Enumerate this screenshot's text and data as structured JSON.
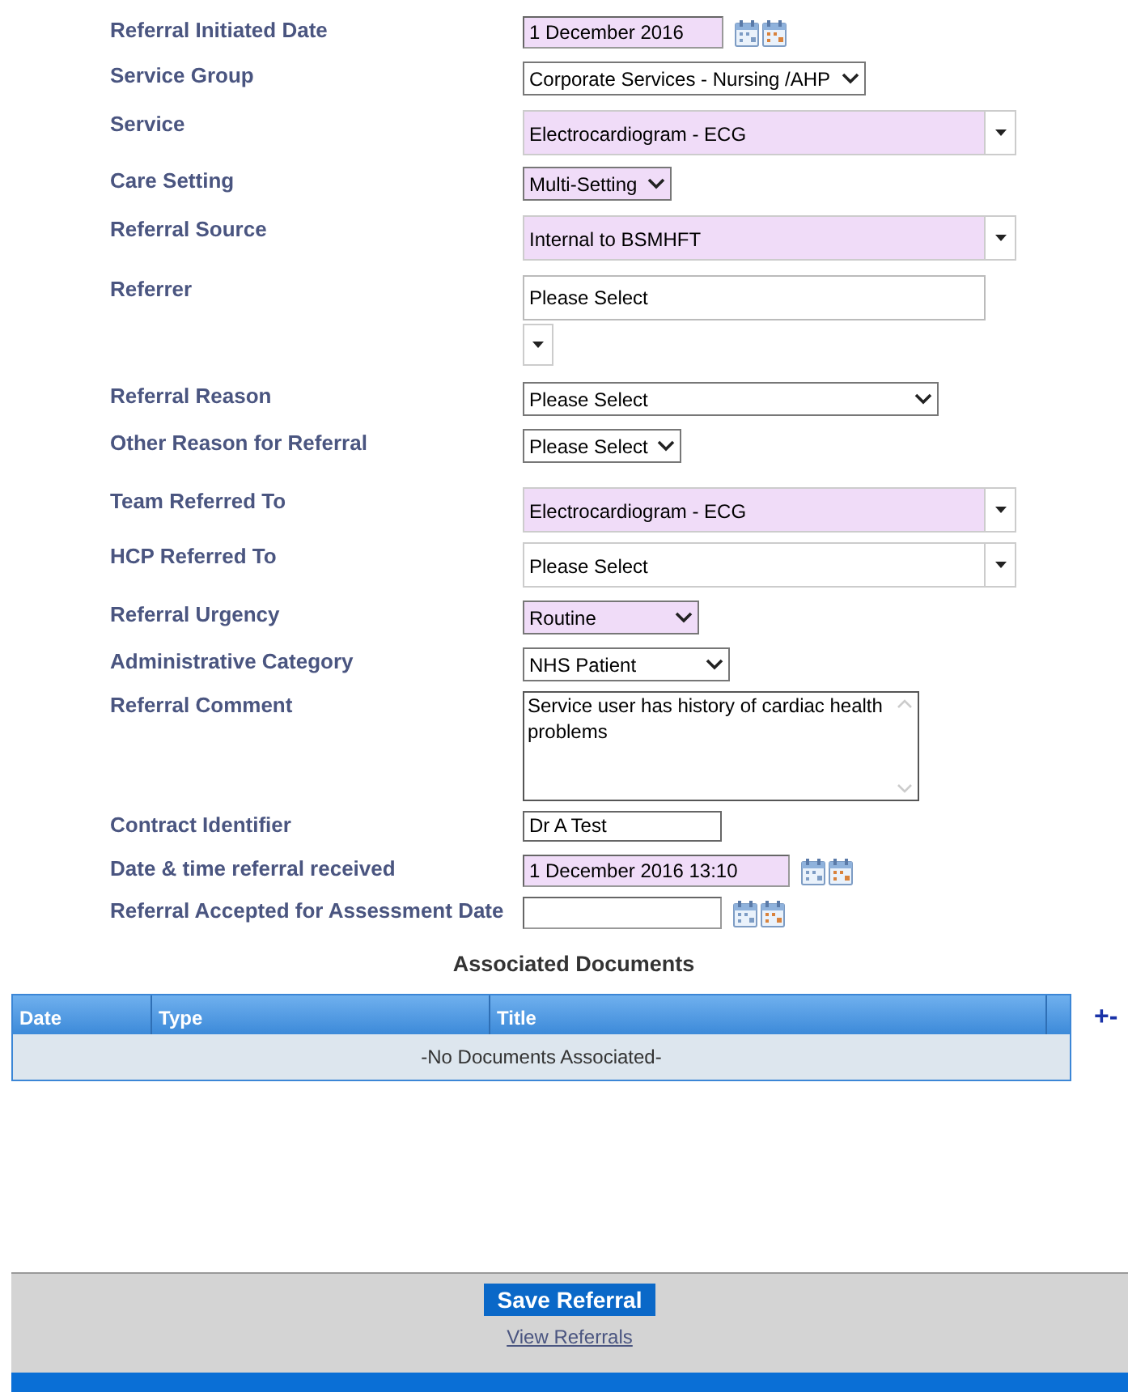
{
  "form": {
    "fields": [
      {
        "label": "Referral Initiated Date",
        "kind": "date",
        "value": "1 December 2016",
        "highlighted": true
      },
      {
        "label": "Service Group",
        "kind": "select",
        "value": "Corporate Services - Nursing /AHP",
        "highlighted": false
      },
      {
        "label": "Service",
        "kind": "combo",
        "value": "Electrocardiogram - ECG",
        "highlighted": true
      },
      {
        "label": "Care Setting",
        "kind": "select",
        "value": "Multi-Setting",
        "highlighted": true
      },
      {
        "label": "Referral Source",
        "kind": "combo",
        "value": "Internal to BSMHFT",
        "highlighted": true
      },
      {
        "label": "Referrer",
        "kind": "lookup",
        "value": "Please Select",
        "highlighted": false
      },
      {
        "label": "Referral Reason",
        "kind": "select",
        "value": "Please Select",
        "highlighted": false
      },
      {
        "label": "Other Reason for Referral",
        "kind": "select",
        "value": "Please Select",
        "highlighted": false
      },
      {
        "label": "Team Referred To",
        "kind": "combo",
        "value": "Electrocardiogram - ECG",
        "highlighted": true
      },
      {
        "label": "HCP Referred To",
        "kind": "combo",
        "value": "Please Select",
        "highlighted": false
      },
      {
        "label": "Referral Urgency",
        "kind": "select",
        "value": "Routine",
        "highlighted": true
      },
      {
        "label": "Administrative Category",
        "kind": "select",
        "value": "NHS Patient",
        "highlighted": false
      },
      {
        "label": "Referral Comment",
        "kind": "textarea",
        "value": "Service user has history of cardiac health problems",
        "highlighted": false
      },
      {
        "label": "Contract Identifier",
        "kind": "text",
        "value": "Dr A Test",
        "highlighted": false
      },
      {
        "label": "Date & time referral received",
        "kind": "date",
        "value": "1 December 2016 13:10",
        "highlighted": true
      },
      {
        "label": "Referral Accepted for Assessment Date",
        "kind": "date",
        "highlighted": false
      }
    ]
  },
  "documents": {
    "title": "Associated Documents",
    "columns": [
      "Date",
      "Type",
      "Title"
    ],
    "empty_text": "-No Documents Associated-",
    "add_remove": "+-"
  },
  "footer": {
    "save_button": "Save Referral",
    "link": "View Referrals"
  }
}
